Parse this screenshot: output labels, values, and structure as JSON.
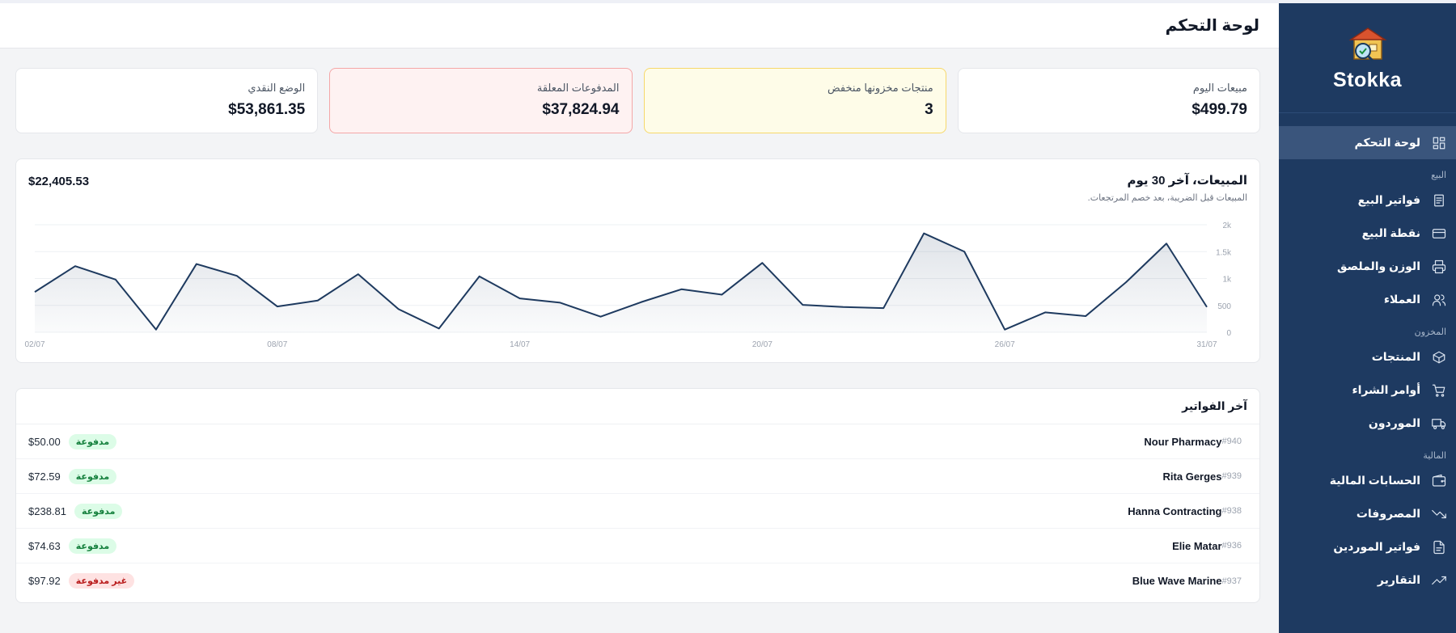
{
  "app": {
    "name": "Stokka"
  },
  "header": {
    "title": "لوحة التحكم"
  },
  "sidebar": {
    "items": [
      {
        "label": "لوحة التحكم",
        "icon": "dashboard-icon",
        "active": true
      },
      {
        "section": "البيع"
      },
      {
        "label": "فواتير البيع",
        "icon": "receipt-icon"
      },
      {
        "label": "نقطة البيع",
        "icon": "credit-card-icon"
      },
      {
        "label": "الوزن والملصق",
        "icon": "printer-icon"
      },
      {
        "label": "العملاء",
        "icon": "users-icon"
      },
      {
        "section": "المخزون"
      },
      {
        "label": "المنتجات",
        "icon": "box-icon"
      },
      {
        "label": "أوامر الشراء",
        "icon": "cart-icon"
      },
      {
        "label": "الموردون",
        "icon": "truck-icon"
      },
      {
        "section": "المالية"
      },
      {
        "label": "الحسابات المالية",
        "icon": "wallet-icon"
      },
      {
        "label": "المصروفات",
        "icon": "trending-down-icon"
      },
      {
        "label": "فواتير الموردين",
        "icon": "file-icon"
      },
      {
        "label": "التقارير",
        "icon": "trending-up-icon"
      }
    ]
  },
  "cards": [
    {
      "label": "مبيعات اليوم",
      "value": "$499.79",
      "tone": "default"
    },
    {
      "label": "منتجات مخزونها منخفض",
      "value": "3",
      "tone": "yellow"
    },
    {
      "label": "المدفوعات المعلقة",
      "value": "$37,824.94",
      "tone": "red"
    },
    {
      "label": "الوضع النقدي",
      "value": "$53,861.35",
      "tone": "default"
    }
  ],
  "sales_chart": {
    "title": "المبيعات، آخر 30 يوم",
    "subtitle": "المبيعات قبل الضريبة، بعد خصم المرتجعات.",
    "total": "$22,405.53"
  },
  "chart_data": {
    "type": "area",
    "x": [
      "02/07",
      "03/07",
      "04/07",
      "05/07",
      "06/07",
      "07/07",
      "08/07",
      "09/07",
      "10/07",
      "11/07",
      "12/07",
      "13/07",
      "14/07",
      "15/07",
      "16/07",
      "17/07",
      "18/07",
      "19/07",
      "20/07",
      "21/07",
      "22/07",
      "23/07",
      "24/07",
      "25/07",
      "26/07",
      "27/07",
      "28/07",
      "29/07",
      "30/07",
      "31/07"
    ],
    "xticks": [
      "02/07",
      "08/07",
      "14/07",
      "20/07",
      "26/07",
      "31/07"
    ],
    "yticks": [
      "0",
      "500",
      "1k",
      "1.5k",
      "2k"
    ],
    "y": [
      750,
      1230,
      980,
      50,
      1270,
      1050,
      480,
      590,
      1080,
      430,
      70,
      1040,
      630,
      550,
      290,
      560,
      800,
      700,
      1290,
      510,
      470,
      450,
      1840,
      1500,
      50,
      370,
      300,
      930,
      1650,
      470
    ],
    "ylim": [
      0,
      2000
    ],
    "color": "#1e3a5f",
    "grid": true
  },
  "invoices": {
    "title": "آخر الفواتير",
    "rows": [
      {
        "number": "#940",
        "customer": "Nour Pharmacy",
        "status": "مدفوعة",
        "paid": true,
        "amount": "$50.00"
      },
      {
        "number": "#939",
        "customer": "Rita Gerges",
        "status": "مدفوعة",
        "paid": true,
        "amount": "$72.59"
      },
      {
        "number": "#938",
        "customer": "Hanna Contracting",
        "status": "مدفوعة",
        "paid": true,
        "amount": "$238.81"
      },
      {
        "number": "#936",
        "customer": "Elie Matar",
        "status": "مدفوعة",
        "paid": true,
        "amount": "$74.63"
      },
      {
        "number": "#937",
        "customer": "Blue Wave Marine",
        "status": "غير مدفوعة",
        "paid": false,
        "amount": "$97.92"
      }
    ]
  }
}
